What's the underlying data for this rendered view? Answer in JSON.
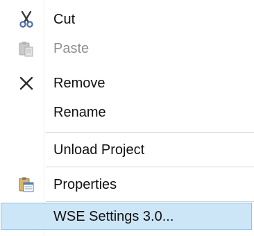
{
  "menu": {
    "items": [
      {
        "label": "Cut",
        "icon": "scissors-icon",
        "enabled": true
      },
      {
        "label": "Paste",
        "icon": "clipboard-paste-icon",
        "enabled": false
      },
      {
        "label": "Remove",
        "icon": "remove-x-icon",
        "enabled": true
      },
      {
        "label": "Rename",
        "icon": "",
        "enabled": true
      },
      {
        "label": "Unload Project",
        "icon": "",
        "enabled": true
      },
      {
        "label": "Properties",
        "icon": "properties-icon",
        "enabled": true
      },
      {
        "label": "WSE Settings 3.0...",
        "icon": "",
        "enabled": true,
        "highlighted": true
      }
    ]
  },
  "colors": {
    "highlight_fill": "#cde6f7",
    "highlight_border": "#8ec2eb",
    "text": "#111111",
    "disabled_text": "#8f8f8f"
  }
}
